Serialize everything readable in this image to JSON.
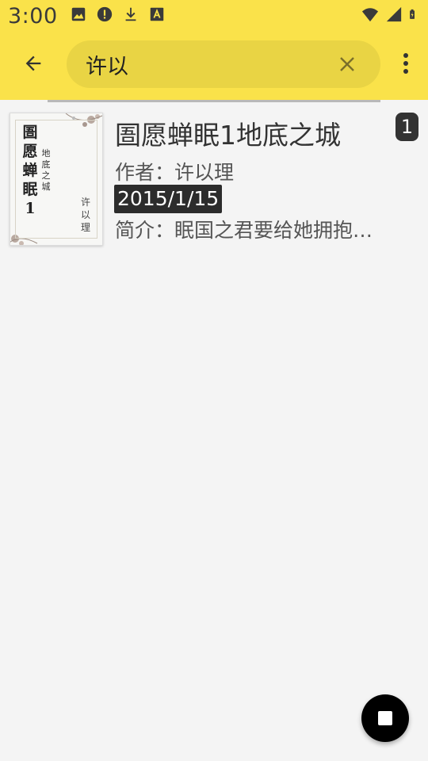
{
  "status_bar": {
    "time": "3:00",
    "icons_left": [
      "image-icon",
      "alert-icon",
      "download-icon",
      "font-icon"
    ],
    "icons_right": [
      "wifi-icon",
      "signal-icon",
      "battery-charging-icon"
    ]
  },
  "app_bar": {
    "back_icon": "arrow-back-icon",
    "search_value": "许以",
    "clear_icon": "close-icon",
    "more_icon": "more-vert-icon",
    "background": "#fae24a"
  },
  "results": [
    {
      "cover": {
        "title": "圄愿蝉眠1",
        "subtitle": "地底之城",
        "author": "许以理"
      },
      "title": "圄愿蝉眠1地底之城",
      "author": "作者：许以理",
      "date": "2015/1/15",
      "intro": "简介：眠国之君要给她拥抱…",
      "badge": "1"
    }
  ],
  "fab": {
    "icon": "stop-icon"
  }
}
